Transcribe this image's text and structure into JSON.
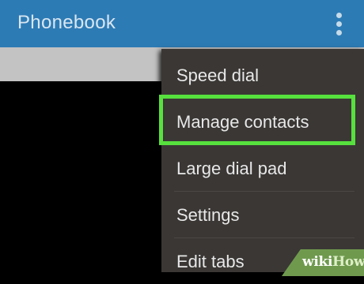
{
  "app_bar": {
    "title": "Phonebook",
    "more_icon": "more-vert-icon",
    "color": "#2d7bb5"
  },
  "menu": {
    "items": [
      {
        "label": "Speed dial"
      },
      {
        "label": "Manage contacts",
        "highlighted": true
      },
      {
        "label": "Large dial pad"
      },
      {
        "label": "Settings"
      },
      {
        "label": "Edit tabs"
      }
    ],
    "highlight_color": "#57e13e"
  },
  "watermark": {
    "part1": "wiki",
    "part2": "How"
  }
}
